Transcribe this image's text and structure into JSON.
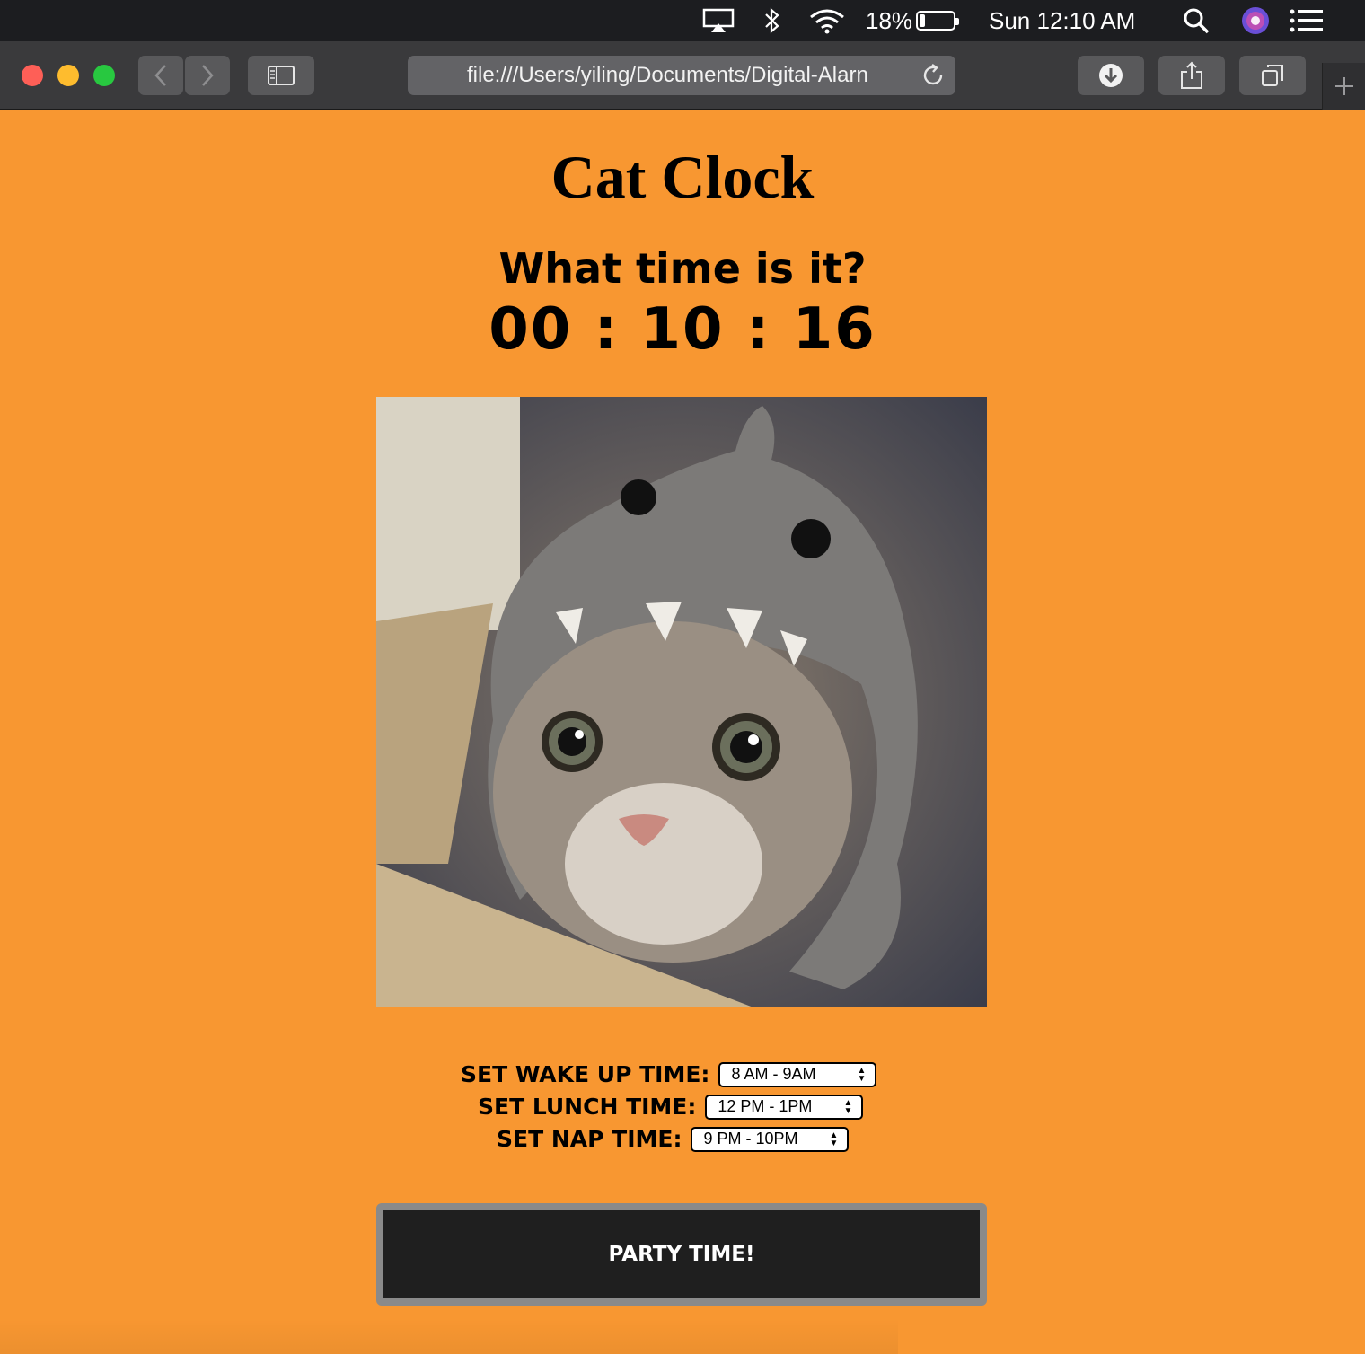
{
  "menubar": {
    "battery_percent": "18%",
    "battery_level": 0.18,
    "datetime": "Sun 12:10 AM",
    "icons": [
      "airplay-icon",
      "bluetooth-icon",
      "wifi-icon",
      "battery-icon",
      "spotlight-search-icon",
      "siri-icon",
      "notification-center-icon"
    ]
  },
  "browser": {
    "url": "file:///Users/yiling/Documents/Digital-Alarn",
    "colors": {
      "close": "#fe5f57",
      "minimize": "#febc2e",
      "zoom": "#28c840"
    }
  },
  "page": {
    "title": "Cat Clock",
    "question": "What time is it?",
    "clock": "00 : 10 : 16",
    "image_subject": "cat wearing a knitted shark hat",
    "wake_label": "SET WAKE UP TIME:",
    "wake_value": "8 AM - 9AM",
    "lunch_label": "SET LUNCH TIME:",
    "lunch_value": "12 PM - 1PM",
    "nap_label": "SET NAP TIME:",
    "nap_value": "9 PM - 10PM",
    "party_button": "PARTY TIME!",
    "colors": {
      "background": "#f89731",
      "button": "#1f1f1f",
      "button_border": "#8a8a8a"
    }
  }
}
